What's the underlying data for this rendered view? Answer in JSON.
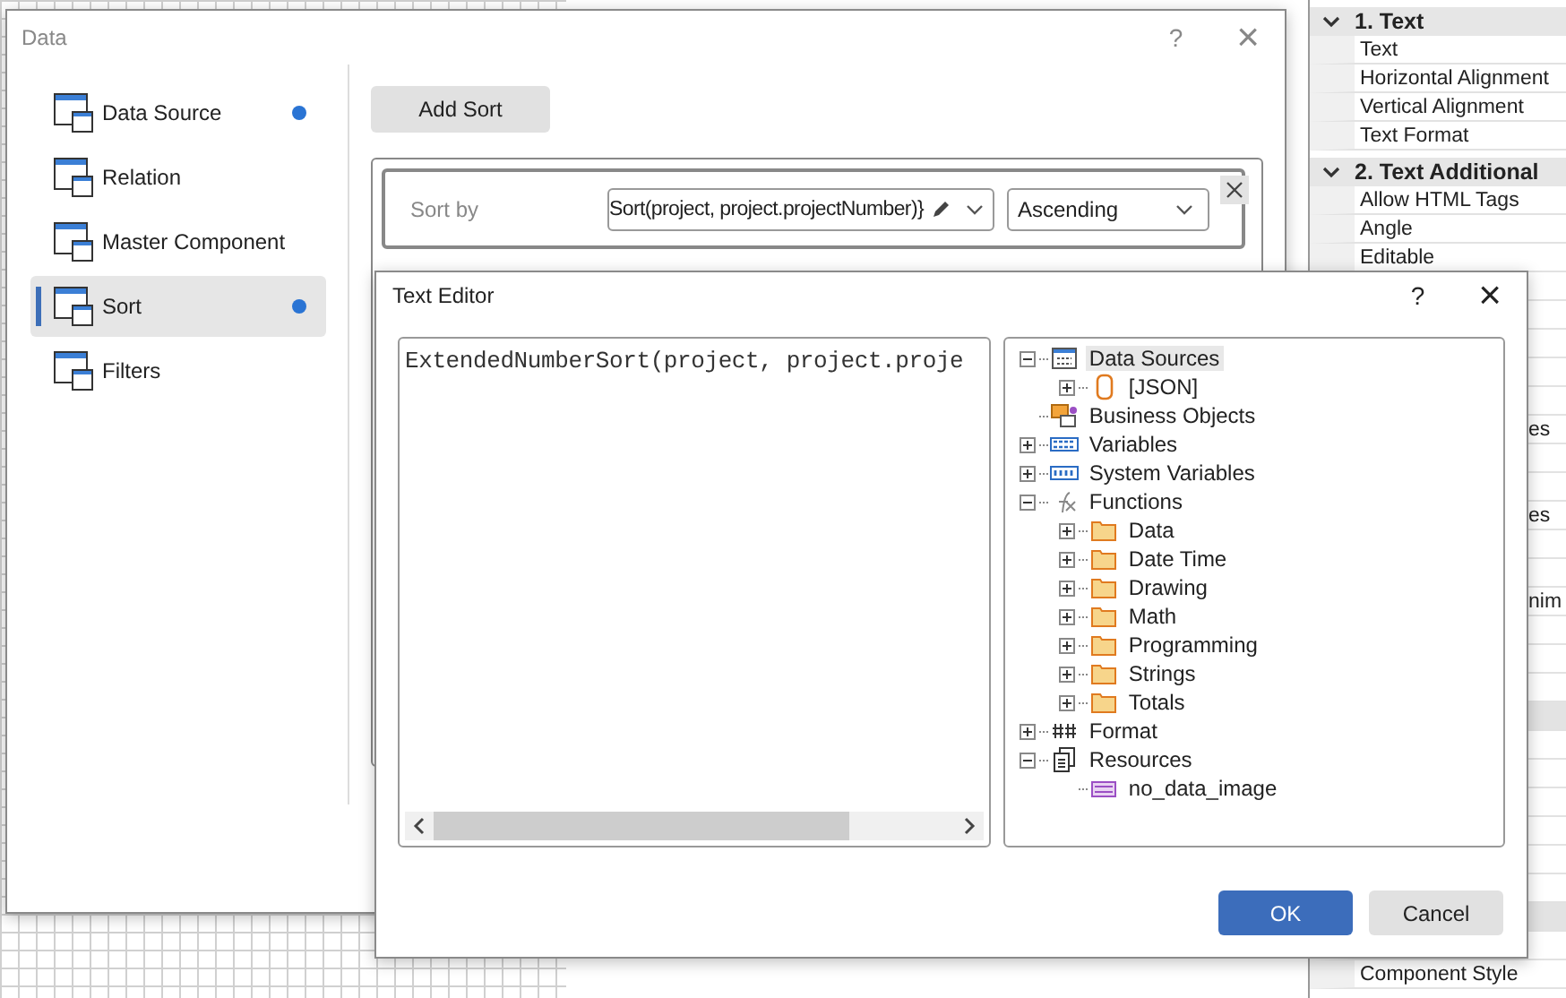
{
  "properties": {
    "sections": [
      {
        "title": "1. Text",
        "expanded": true,
        "rows": [
          {
            "kind": "row",
            "label": "Text"
          },
          {
            "kind": "row",
            "label": "Horizontal Alignment"
          },
          {
            "kind": "row",
            "label": "Vertical Alignment"
          },
          {
            "kind": "row",
            "label": "Text Format"
          }
        ]
      },
      {
        "title": "2. Text  Additional",
        "expanded": true,
        "rows": [
          {
            "kind": "row",
            "label": "Allow HTML Tags"
          },
          {
            "kind": "row",
            "label": "Angle"
          },
          {
            "kind": "row",
            "label": "Editable"
          },
          {
            "kind": "blank"
          },
          {
            "kind": "blank"
          },
          {
            "kind": "blank"
          },
          {
            "kind": "blank"
          },
          {
            "kind": "blank"
          },
          {
            "kind": "clipped",
            "label": "es"
          },
          {
            "kind": "blank"
          },
          {
            "kind": "blank"
          },
          {
            "kind": "clipped",
            "label": "es"
          },
          {
            "kind": "blank"
          },
          {
            "kind": "blank"
          },
          {
            "kind": "clipped",
            "label": "nim"
          },
          {
            "kind": "blank"
          },
          {
            "kind": "blank"
          },
          {
            "kind": "blank"
          },
          {
            "kind": "gray"
          },
          {
            "kind": "blank"
          },
          {
            "kind": "blank"
          },
          {
            "kind": "blank"
          },
          {
            "kind": "blank"
          },
          {
            "kind": "blank"
          },
          {
            "kind": "blank"
          },
          {
            "kind": "gray"
          },
          {
            "kind": "blank"
          },
          {
            "kind": "row",
            "label": "Component Style"
          }
        ]
      }
    ]
  },
  "data_dialog": {
    "title": "Data",
    "help": "?",
    "close": "×",
    "sidebar": [
      {
        "label": "Data Source",
        "selected": false,
        "has_value": true
      },
      {
        "label": "Relation",
        "selected": false,
        "has_value": false
      },
      {
        "label": "Master Component",
        "selected": false,
        "has_value": false
      },
      {
        "label": "Sort",
        "selected": true,
        "has_value": true
      },
      {
        "label": "Filters",
        "selected": false,
        "has_value": false
      }
    ],
    "add_button": "Add Sort",
    "sort": {
      "label": "Sort by",
      "expression": "Sort(project, project.projectNumber)}",
      "direction": "Ascending"
    }
  },
  "text_editor": {
    "title": "Text Editor",
    "help": "?",
    "close": "×",
    "code": "ExtendedNumberSort(project, project.proje",
    "tree": [
      {
        "label": "Data Sources",
        "kind": "datasource",
        "expanded": true,
        "selected": true,
        "children": [
          {
            "label": "[JSON]",
            "kind": "database",
            "expanded": false,
            "selected": false
          }
        ]
      },
      {
        "label": "Business Objects",
        "kind": "business",
        "selected": false
      },
      {
        "label": "Variables",
        "kind": "var",
        "expanded": false,
        "selected": false
      },
      {
        "label": "System Variables",
        "kind": "sysvar",
        "expanded": false,
        "selected": false
      },
      {
        "label": "Functions",
        "kind": "fx",
        "expanded": true,
        "selected": false,
        "children": [
          {
            "label": "Data",
            "kind": "folder",
            "expanded": false,
            "selected": false
          },
          {
            "label": "Date Time",
            "kind": "folder",
            "expanded": false,
            "selected": false
          },
          {
            "label": "Drawing",
            "kind": "folder",
            "expanded": false,
            "selected": false
          },
          {
            "label": "Math",
            "kind": "folder",
            "expanded": false,
            "selected": false
          },
          {
            "label": "Programming",
            "kind": "folder",
            "expanded": false,
            "selected": false
          },
          {
            "label": "Strings",
            "kind": "folder",
            "expanded": false,
            "selected": false
          },
          {
            "label": "Totals",
            "kind": "folder",
            "expanded": false,
            "selected": false
          }
        ]
      },
      {
        "label": "Format",
        "kind": "format",
        "expanded": false,
        "selected": false
      },
      {
        "label": "Resources",
        "kind": "resources",
        "expanded": true,
        "selected": false,
        "children": [
          {
            "label": "no_data_image",
            "kind": "image",
            "selected": false
          }
        ]
      }
    ],
    "ok": "OK",
    "cancel": "Cancel"
  }
}
